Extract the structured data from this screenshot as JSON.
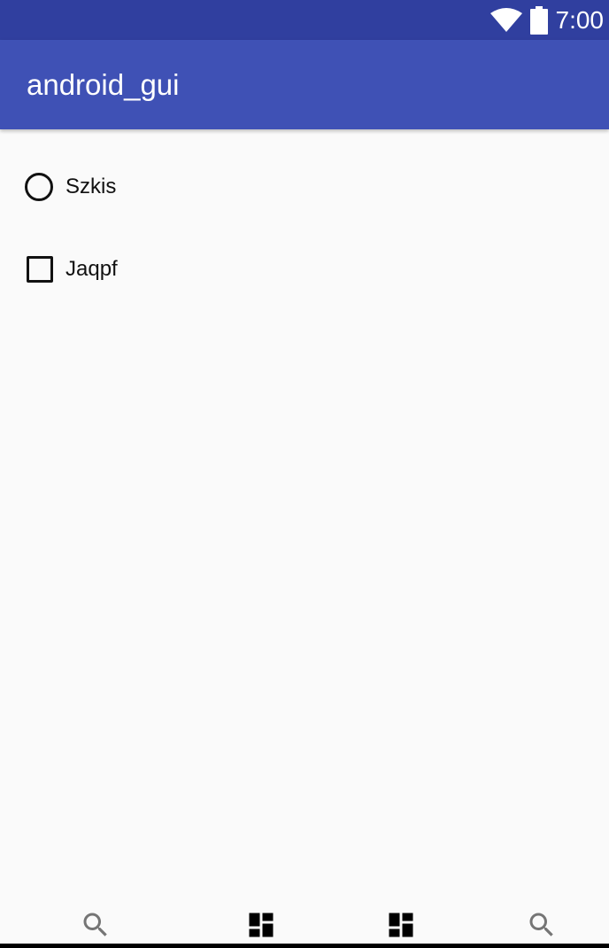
{
  "status_bar": {
    "time": "7:00",
    "icons": [
      "wifi-icon",
      "battery-icon"
    ],
    "background": "#303f9f"
  },
  "app_bar": {
    "title": "android_gui",
    "background": "#3f51b5"
  },
  "options": {
    "radio": {
      "label": "Szkis",
      "checked": false
    },
    "checkbox": {
      "label": "Jaqpf",
      "checked": false
    }
  },
  "bottom_nav": {
    "icons": [
      "search-icon",
      "dashboard-icon",
      "dashboard-icon",
      "search-icon"
    ],
    "search_icon_color": "#757575",
    "dashboard_icon_color": "#000000"
  }
}
